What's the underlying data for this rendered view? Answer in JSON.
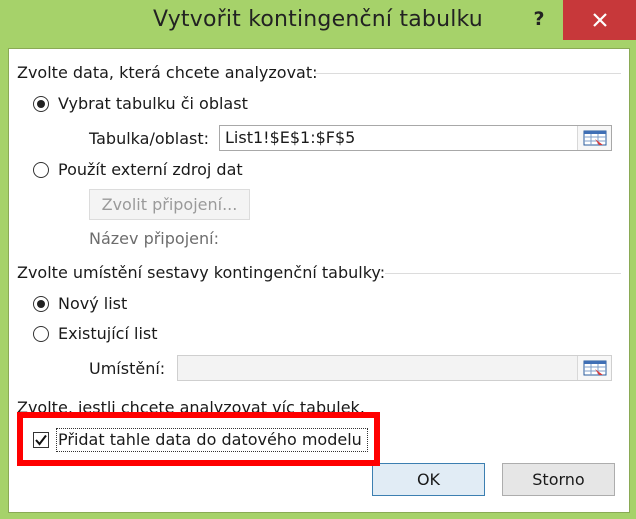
{
  "window": {
    "title": "Vytvořit kontingenční tabulku",
    "help_label": "?"
  },
  "data_section": {
    "heading": "Zvolte data, která chcete analyzovat:",
    "option_table": "Vybrat tabulku či oblast",
    "table_range_label": "Tabulka/oblast:",
    "table_range_value": "List1!$E$1:$F$5",
    "option_external": "Použít externí zdroj dat",
    "choose_connection_button": "Zvolit připojení...",
    "connection_name_label": "Název připojení:"
  },
  "location_section": {
    "heading": "Zvolte umístění sestavy kontingenční tabulky:",
    "option_new_sheet": "Nový list",
    "option_existing_sheet": "Existující list",
    "location_label": "Umístění:",
    "location_value": ""
  },
  "multi_table_section": {
    "heading": "Zvolte, jestli chcete analyzovat víc tabulek.",
    "add_to_model_label": "Přidat tahle data do datového modelu",
    "add_to_model_checked": true
  },
  "buttons": {
    "ok": "OK",
    "cancel": "Storno"
  },
  "colors": {
    "title_bar": "#a6d26a",
    "close_button": "#c7383a",
    "highlight": "#ff0000"
  }
}
